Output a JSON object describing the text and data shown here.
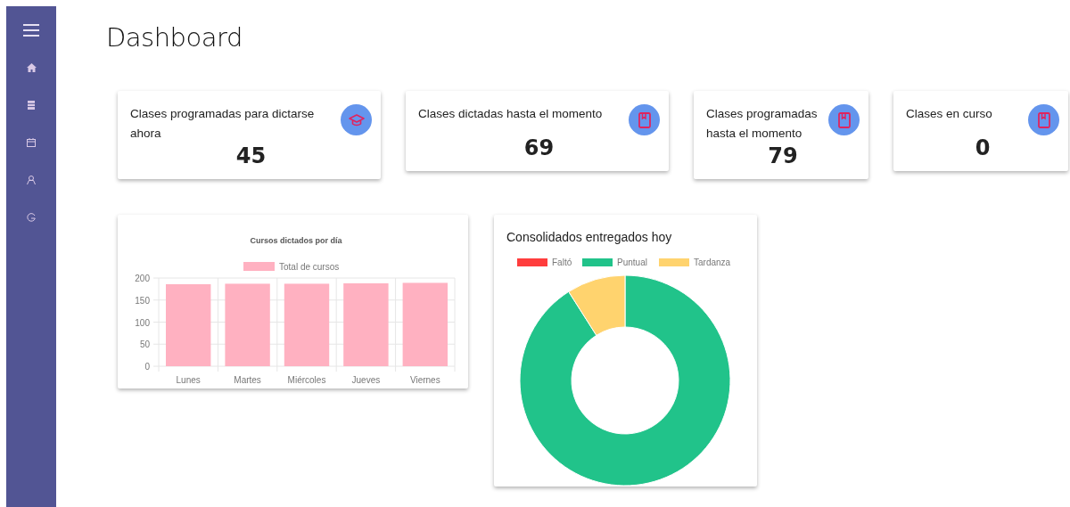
{
  "page": {
    "title": "Dashboard"
  },
  "sidebar": {
    "items": [
      {
        "kind": "home"
      },
      {
        "kind": "list"
      },
      {
        "kind": "calendar"
      },
      {
        "kind": "user"
      },
      {
        "kind": "logout"
      }
    ]
  },
  "stats": [
    {
      "label": "Clases programadas para dictarse ahora",
      "value": "45",
      "kind": "cap"
    },
    {
      "label": "Clases dictadas hasta el momento",
      "value": "69",
      "kind": "book"
    },
    {
      "label": "Clases programadas hasta el momento",
      "value": "79",
      "kind": "book"
    },
    {
      "label": "Clases en curso",
      "value": "0",
      "kind": "book"
    }
  ],
  "bar_chart": {
    "chart_data": {
      "type": "bar",
      "title": "Cursos dictados por día",
      "categories": [
        "Lunes",
        "Martes",
        "Miércoles",
        "Jueves",
        "Viernes"
      ],
      "series": [
        {
          "name": "Total de cursos",
          "color": "#ffb1c1",
          "values": [
            186,
            187,
            187,
            188,
            189
          ]
        }
      ],
      "ylim": [
        0,
        200
      ],
      "yticks": [
        0,
        50,
        100,
        150,
        200
      ],
      "grid": true
    }
  },
  "donut_card": {
    "title": "Consolidados entregados hoy",
    "legend": [
      {
        "label": "Faltó",
        "color": "#ff3d3d"
      },
      {
        "label": "Puntual",
        "color": "#21c38a"
      },
      {
        "label": "Tardanza",
        "color": "#ffd36e"
      }
    ]
  }
}
